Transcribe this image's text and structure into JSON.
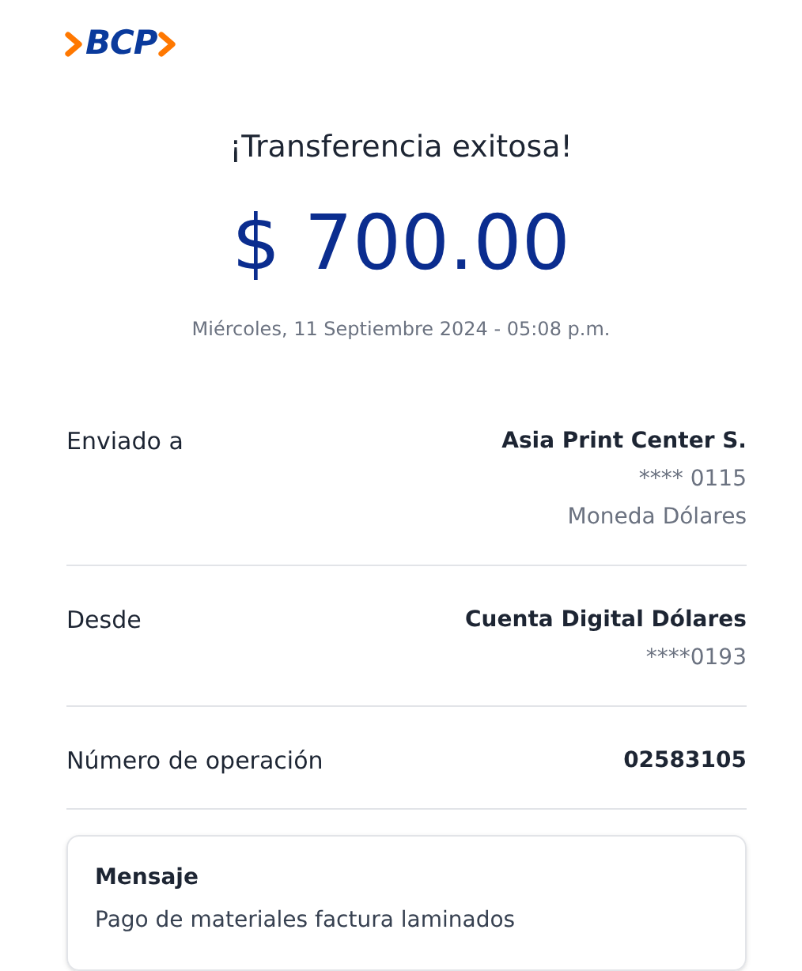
{
  "logo": {
    "text": "BCP"
  },
  "title": "¡Transferencia exitosa!",
  "amount": "$ 700.00",
  "datetime": "Miércoles, 11 Septiembre 2024 - 05:08 p.m.",
  "details": [
    {
      "label": "Enviado a",
      "lines": [
        "Asia Print Center S.",
        "**** 0115",
        "Moneda Dólares"
      ]
    },
    {
      "label": "Desde",
      "lines": [
        "Cuenta Digital Dólares",
        "****0193"
      ]
    },
    {
      "label": "Número de operación",
      "lines": [
        "02583105"
      ]
    }
  ],
  "message": {
    "heading": "Mensaje",
    "text": "Pago de materiales factura laminados"
  }
}
